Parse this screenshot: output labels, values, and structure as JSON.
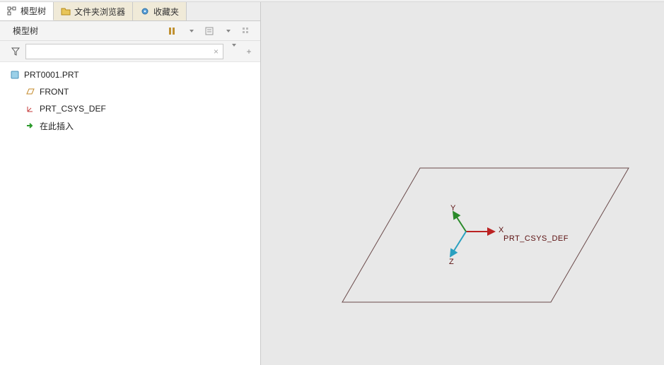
{
  "tabs": {
    "model_tree": "模型树",
    "folder_browser": "文件夹浏览器",
    "favorites": "收藏夹"
  },
  "panel": {
    "title": "模型树"
  },
  "search": {
    "placeholder": "",
    "value": "",
    "clear_glyph": "×"
  },
  "toolbar": {
    "filter_caret": "▼",
    "plus_glyph": "+"
  },
  "tree": {
    "root": "PRT0001.PRT",
    "front": "FRONT",
    "csys": "PRT_CSYS_DEF",
    "insert_here": "在此插入"
  },
  "viewport": {
    "csys_label": "PRT_CSYS_DEF",
    "axis_x": "X",
    "axis_y": "Y",
    "axis_z": "Z"
  }
}
